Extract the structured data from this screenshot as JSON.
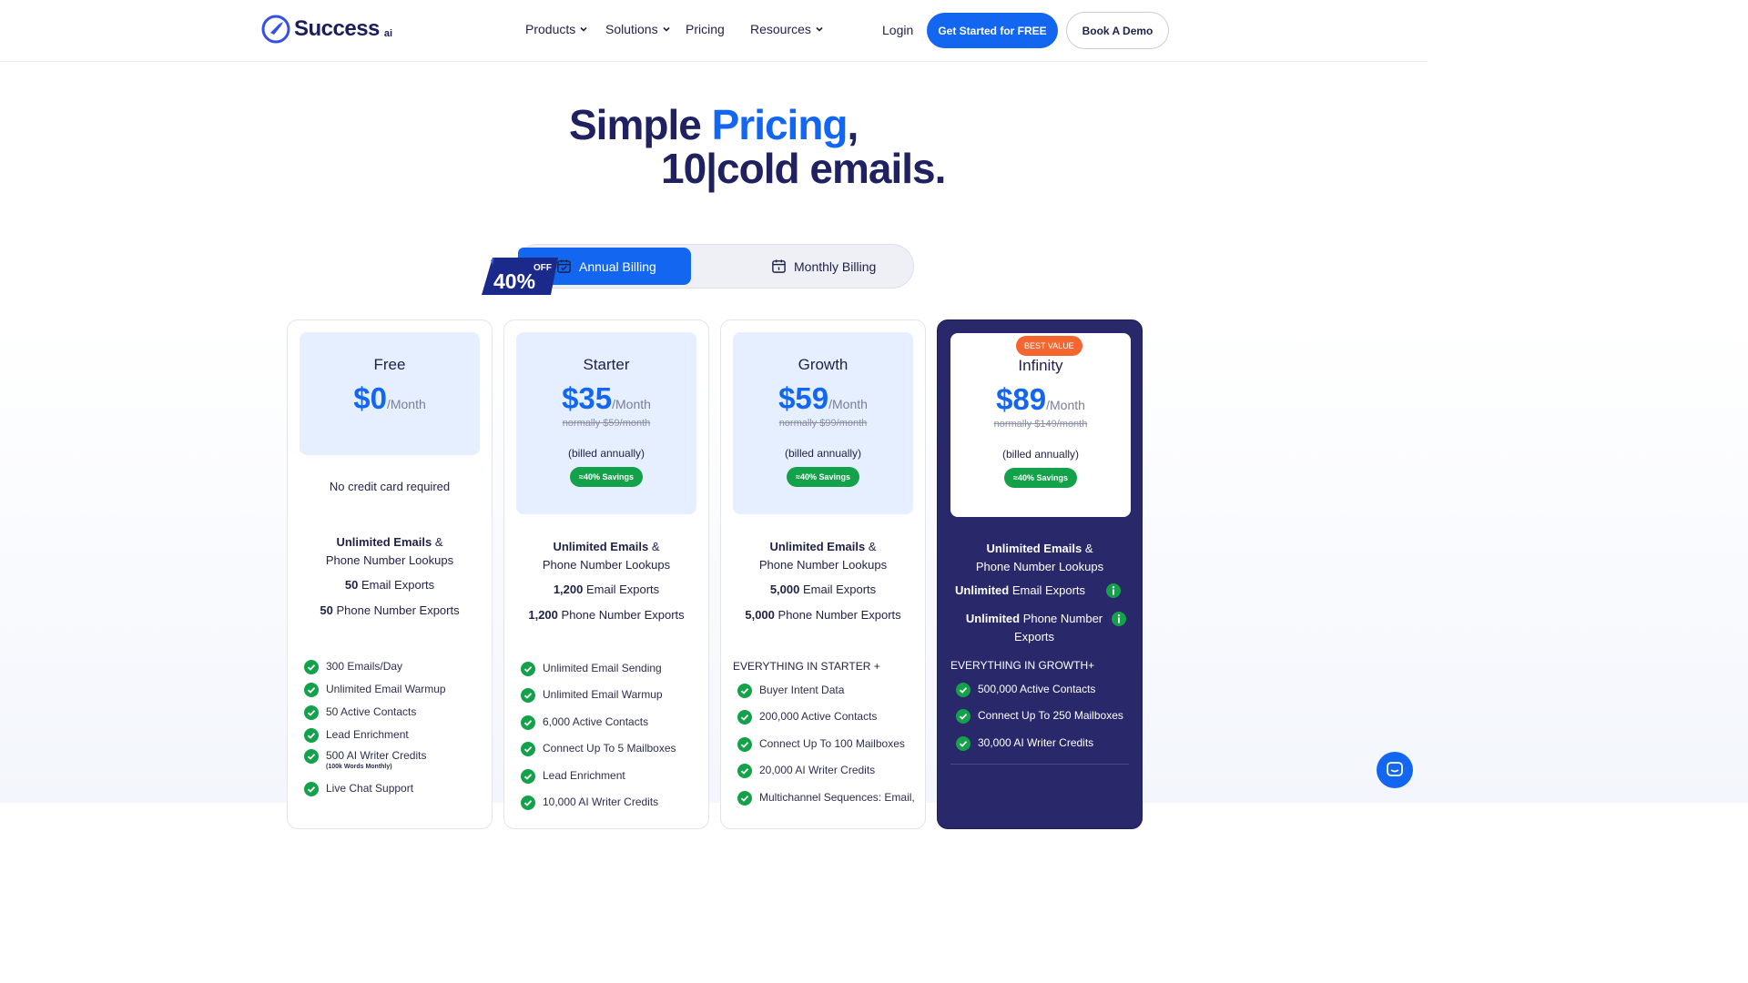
{
  "nav": {
    "brand": "Success",
    "brand_suffix": "ai",
    "links": [
      "Products",
      "Solutions",
      "Pricing",
      "Resources"
    ],
    "login": "Login",
    "cta_primary": "Get Started for FREE",
    "cta_secondary": "Book A Demo"
  },
  "hero": {
    "line1_a": "Simple ",
    "line1_accent": "Pricing",
    "line1_b": ",",
    "line2": "10|cold emails."
  },
  "billing": {
    "annual": "Annual Billing",
    "monthly": "Monthly Billing",
    "ribbon_off": "OFF",
    "ribbon_pct": "40%"
  },
  "plans": [
    {
      "name": "Free",
      "price": "$0",
      "per": "/Month",
      "note": "No credit card required",
      "emails_bold": "Unlimited Emails",
      "emails_rest": " &",
      "lookups": "Phone Number Lookups",
      "email_exports_n": "50",
      "email_exports_label": " Email Exports",
      "phone_exports_n": "50",
      "phone_exports_label": "  Phone Number Exports",
      "features": [
        "300 Emails/Day",
        "Unlimited Email Warmup",
        "50  Active Contacts",
        "Lead Enrichment",
        "500 AI Writer Credits",
        "Live Chat Support"
      ],
      "feature_sub": "(100k Words Monthly)"
    },
    {
      "name": "Starter",
      "price": "$35",
      "per": "/Month",
      "normally": "normally $59/month",
      "billed": "(billed annually)",
      "savings": "≈40% Savings",
      "emails_bold": "Unlimited Emails",
      "emails_rest": " &",
      "lookups": "Phone Number Lookups",
      "email_exports_n": "1,200",
      "email_exports_label": " Email Exports",
      "phone_exports_n": "1,200",
      "phone_exports_label": " Phone Number Exports",
      "features": [
        "Unlimited Email Sending",
        "Unlimited Email Warmup",
        "6,000 Active Contacts",
        "Connect Up To 5 Mailboxes",
        "Lead Enrichment",
        "10,000 AI Writer Credits"
      ]
    },
    {
      "name": "Growth",
      "price": "$59",
      "per": "/Month",
      "normally": "normally $99/month",
      "billed": "(billed annually)",
      "savings": "≈40% Savings",
      "emails_bold": "Unlimited Emails",
      "emails_rest": " &",
      "lookups": "Phone Number Lookups",
      "email_exports_n": "5,000",
      "email_exports_label": " Email Exports",
      "phone_exports_n": "5,000",
      "phone_exports_label": " Phone Number Exports",
      "section": "EVERYTHING IN STARTER +",
      "features": [
        "Buyer Intent Data",
        "200,000 Active Contacts",
        "Connect Up To 100 Mailboxes",
        "20,000 AI Writer Credits",
        "Multichannel Sequences: Email,"
      ]
    },
    {
      "name": "Infinity",
      "badge": "BEST VALUE",
      "price": "$89",
      "per": "/Month",
      "normally": "normally $149/month",
      "billed": "(billed annually)",
      "savings": "≈40% Savings",
      "emails_bold": "Unlimited Emails",
      "emails_rest": " &",
      "lookups": "Phone Number Lookups",
      "email_exports_bold": "Unlimited",
      "email_exports_label": " Email Exports",
      "phone_exports_bold": "Unlimited",
      "phone_exports_label": " Phone Number",
      "phone_exports_label2": "Exports",
      "section": "EVERYTHING IN GROWTH+",
      "features": [
        "500,000 Active Contacts",
        "Connect Up To 250 Mailboxes",
        "30,000 AI Writer Credits"
      ]
    }
  ],
  "colors": {
    "brand_blue": "#1366f0",
    "navy": "#28286b",
    "green": "#13a14a",
    "orange": "#f4662f"
  }
}
